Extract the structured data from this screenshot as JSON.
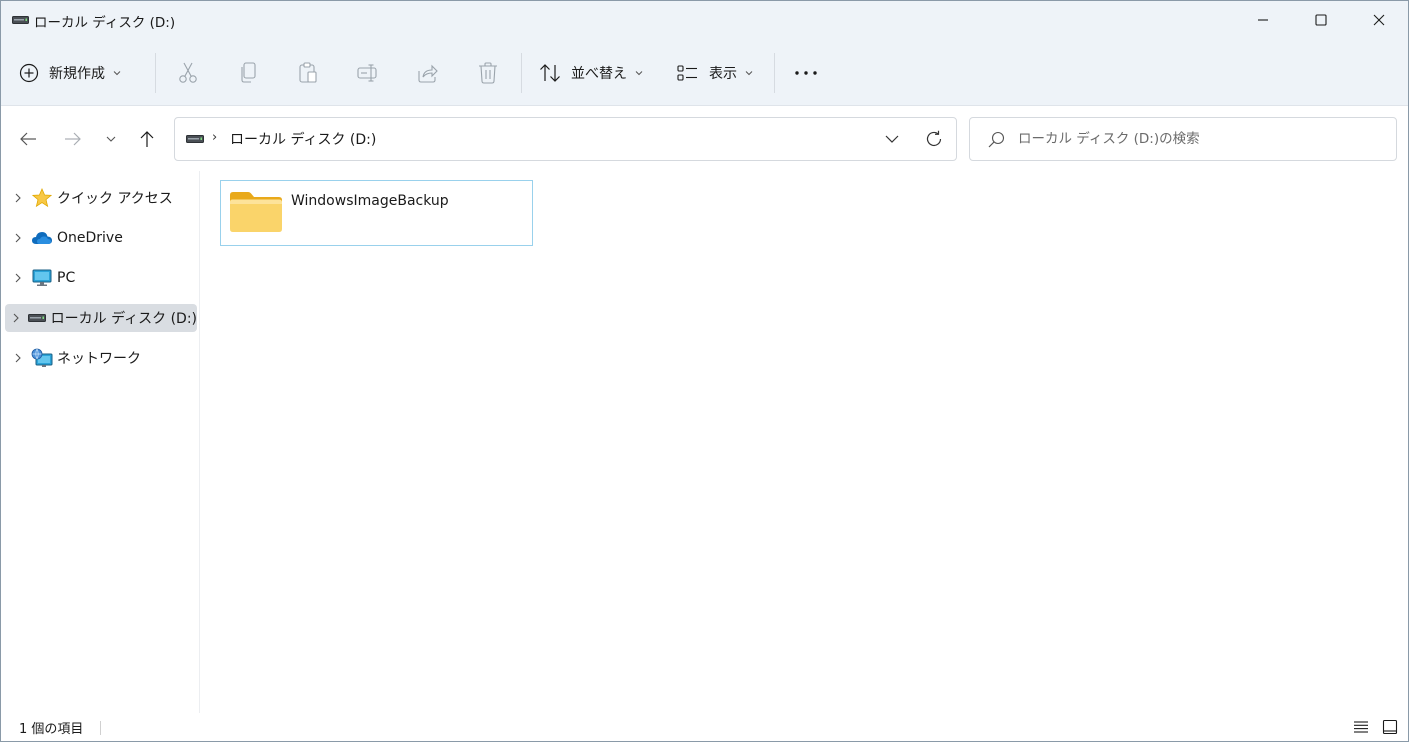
{
  "window": {
    "title": "ローカル ディスク (D:)",
    "controls": {
      "minimize": "minimize-icon",
      "maximize": "maximize-icon",
      "close": "close-icon"
    }
  },
  "toolbar": {
    "new_label": "新規作成",
    "sort_label": "並べ替え",
    "view_label": "表示",
    "icons": [
      "cut-icon",
      "copy-icon",
      "paste-icon",
      "rename-icon",
      "share-icon",
      "delete-icon",
      "more-icon"
    ]
  },
  "address": {
    "path": [
      "ローカル ディスク (D:)"
    ],
    "separator": "›"
  },
  "search": {
    "placeholder": "ローカル ディスク (D:)の検索"
  },
  "sidebar": {
    "items": [
      {
        "label": "クイック アクセス",
        "icon": "star-icon"
      },
      {
        "label": "OneDrive",
        "icon": "cloud-icon"
      },
      {
        "label": "PC",
        "icon": "monitor-icon"
      },
      {
        "label": "ローカル ディスク (D:)",
        "icon": "drive-icon",
        "selected": true
      },
      {
        "label": "ネットワーク",
        "icon": "network-icon"
      }
    ]
  },
  "content": {
    "items": [
      {
        "name": "WindowsImageBackup",
        "type": "folder"
      }
    ]
  },
  "status": {
    "count_text": "1 個の項目"
  },
  "colors": {
    "chrome_bg": "#eef3f8",
    "selection_border": "#99d1ec",
    "folder_yellow": "#f8c845",
    "accent_blue": "#0f6cbd"
  }
}
